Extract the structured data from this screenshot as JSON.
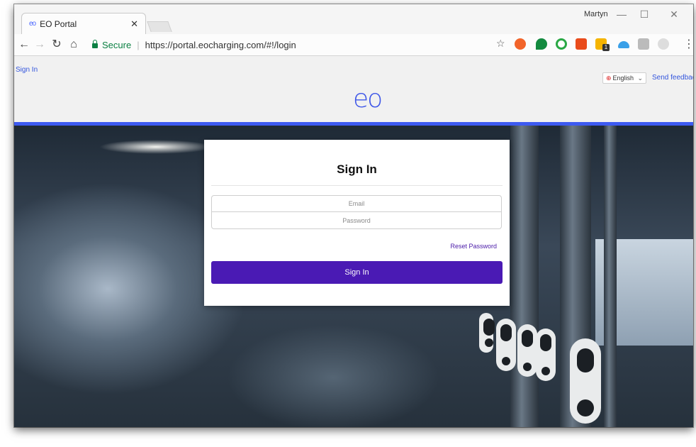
{
  "browser": {
    "tab_title": "EO Portal",
    "tab_favicon": "eo",
    "profile_name": "Martyn",
    "secure_label": "Secure",
    "url": "https://portal.eocharging.com/#!/login",
    "extension_badge": "1"
  },
  "header": {
    "signin_link": "Sign In",
    "language": "English",
    "feedback": "Send feedback",
    "logo": "eo",
    "accent_color": "#3d5af1"
  },
  "form": {
    "title": "Sign In",
    "email_placeholder": "Email",
    "password_placeholder": "Password",
    "reset_link": "Reset Password",
    "submit_label": "Sign In",
    "button_color": "#4a1ab4"
  }
}
